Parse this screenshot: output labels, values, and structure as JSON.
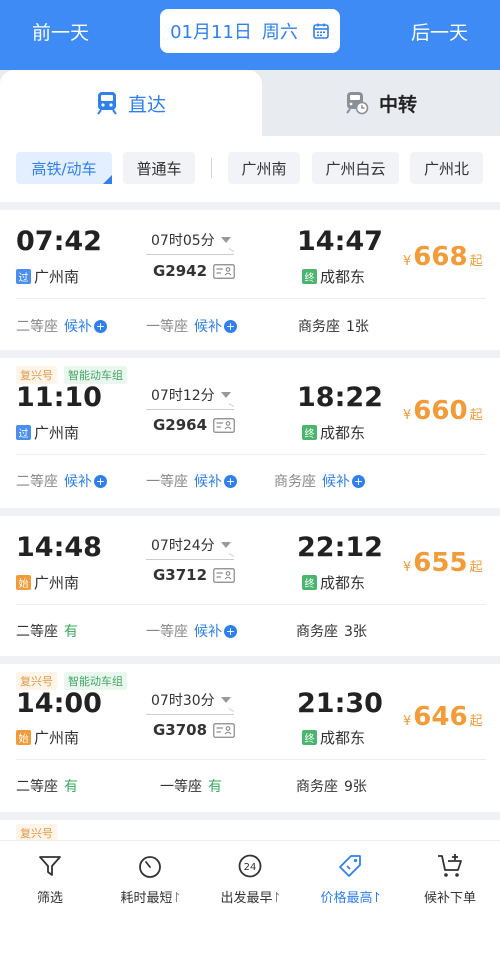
{
  "header": {
    "prev_day": "前一天",
    "date": "01月11日",
    "weekday": "周六",
    "next_day": "后一天",
    "accent_color": "#3e8bf5"
  },
  "tabs": [
    {
      "label": "直达",
      "active": true,
      "icon": "train-icon"
    },
    {
      "label": "中转",
      "active": false,
      "icon": "transfer-train-icon"
    }
  ],
  "filters": [
    {
      "label": "高铁/动车",
      "active": true
    },
    {
      "label": "普通车",
      "active": false
    },
    {
      "label": "广州南",
      "active": false
    },
    {
      "label": "广州白云",
      "active": false
    },
    {
      "label": "广州北",
      "active": false
    }
  ],
  "trains": [
    {
      "tags": [],
      "dep_time": "07:42",
      "dep_badge": "过",
      "dep_station": "广州南",
      "duration": "07时05分",
      "train_no": "G2942",
      "arr_time": "14:47",
      "arr_badge": "终",
      "arr_station": "成都东",
      "price_symbol": "¥",
      "price": "668",
      "price_suffix": "起",
      "seats": [
        {
          "name": "二等座",
          "value": "候补"
        },
        {
          "name": "一等座",
          "value": "候补"
        },
        {
          "name": "商务座",
          "value": "1张"
        }
      ]
    },
    {
      "tags": [
        "复兴号",
        "智能动车组"
      ],
      "dep_time": "11:10",
      "dep_badge": "过",
      "dep_station": "广州南",
      "duration": "07时12分",
      "train_no": "G2964",
      "arr_time": "18:22",
      "arr_badge": "终",
      "arr_station": "成都东",
      "price_symbol": "¥",
      "price": "660",
      "price_suffix": "起",
      "seats": [
        {
          "name": "二等座",
          "value": "候补"
        },
        {
          "name": "一等座",
          "value": "候补"
        },
        {
          "name": "商务座",
          "value": "候补"
        }
      ]
    },
    {
      "tags": [],
      "dep_time": "14:48",
      "dep_badge": "始",
      "dep_station": "广州南",
      "duration": "07时24分",
      "train_no": "G3712",
      "arr_time": "22:12",
      "arr_badge": "终",
      "arr_station": "成都东",
      "price_symbol": "¥",
      "price": "655",
      "price_suffix": "起",
      "seats": [
        {
          "name": "二等座",
          "value": "有"
        },
        {
          "name": "一等座",
          "value": "候补"
        },
        {
          "name": "商务座",
          "value": "3张"
        }
      ]
    },
    {
      "tags": [
        "复兴号",
        "智能动车组"
      ],
      "dep_time": "14:00",
      "dep_badge": "始",
      "dep_station": "广州南",
      "duration": "07时30分",
      "train_no": "G3708",
      "arr_time": "21:30",
      "arr_badge": "终",
      "arr_station": "成都东",
      "price_symbol": "¥",
      "price": "646",
      "price_suffix": "起",
      "seats": [
        {
          "name": "二等座",
          "value": "有"
        },
        {
          "name": "一等座",
          "value": "有"
        },
        {
          "name": "商务座",
          "value": "9张"
        }
      ]
    }
  ],
  "partial_card_tag": "复兴号",
  "bottom_bar": [
    {
      "label": "筛选",
      "icon": "filter-icon",
      "active": false,
      "sort": false
    },
    {
      "label": "耗时最短",
      "icon": "stopwatch-icon",
      "active": false,
      "sort": true
    },
    {
      "label": "出发最早",
      "icon": "clock-24-icon",
      "active": false,
      "sort": true
    },
    {
      "label": "价格最高",
      "icon": "price-tag-icon",
      "active": true,
      "sort": true
    },
    {
      "label": "候补下单",
      "icon": "cart-add-icon",
      "active": false,
      "sort": false
    }
  ]
}
